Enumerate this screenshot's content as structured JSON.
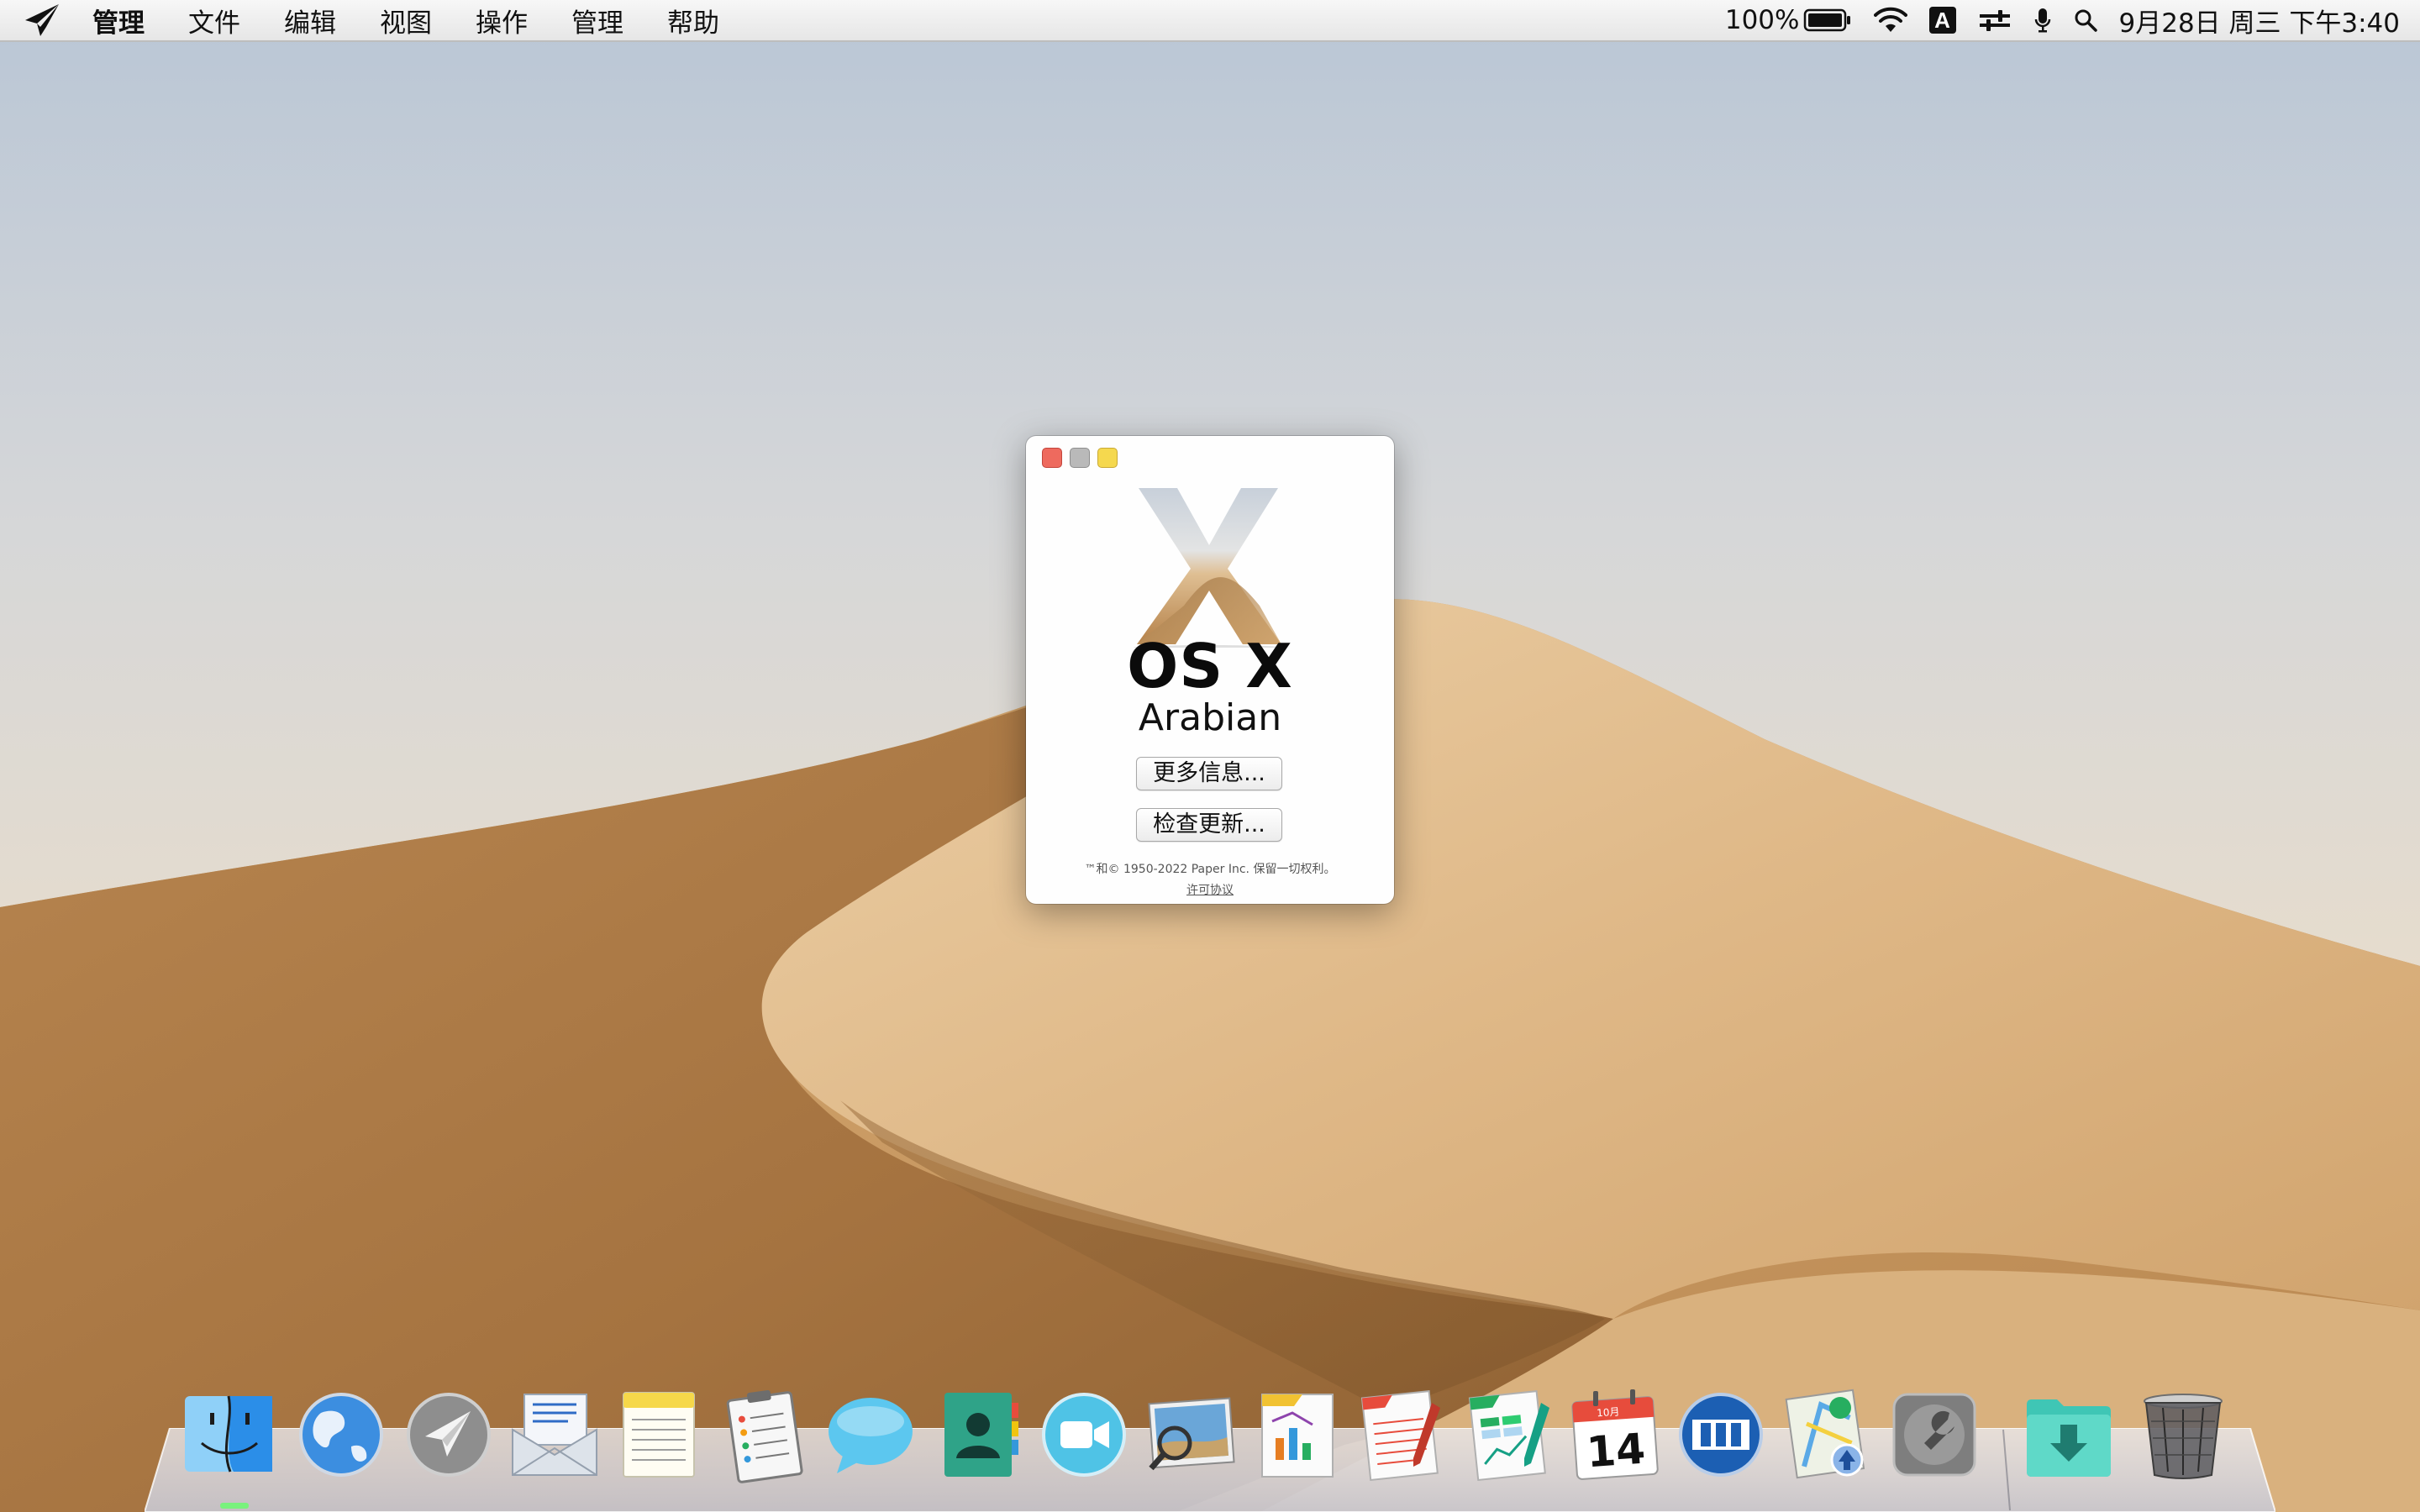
{
  "menubar": {
    "app_name": "管理",
    "menus": [
      "文件",
      "编辑",
      "视图",
      "操作",
      "管理",
      "帮助"
    ],
    "battery_percent": "100%",
    "input_method": "A",
    "datetime": "9月28日 周三 下午3:40"
  },
  "about": {
    "os_name": "OS X",
    "edition": "Arabian",
    "more_info_label": "更多信息...",
    "check_update_label": "检查更新...",
    "copyright": "™和© 1950-2022 Paper Inc. 保留一切权利。",
    "license_link": "许可协议"
  },
  "dock": {
    "apps": [
      "finder-icon",
      "globe-icon",
      "paper-plane-icon",
      "mail-icon",
      "notes-icon",
      "reminders-icon",
      "messages-icon",
      "contacts-icon",
      "facetime-icon",
      "preview-icon",
      "keynote-icon",
      "pages-icon",
      "numbers-icon",
      "calendar-icon",
      "mission-control-icon",
      "maps-icon",
      "system-preferences-icon",
      "downloads-folder-icon",
      "trash-icon"
    ],
    "calendar_month": "10月",
    "calendar_day": "14"
  },
  "colors": {
    "menubar_bg": "#ececec",
    "close": "#ee6a5e",
    "minimize": "#b9b9b9",
    "zoom": "#f5d84e",
    "dock_active_dot": "#79f27d"
  }
}
